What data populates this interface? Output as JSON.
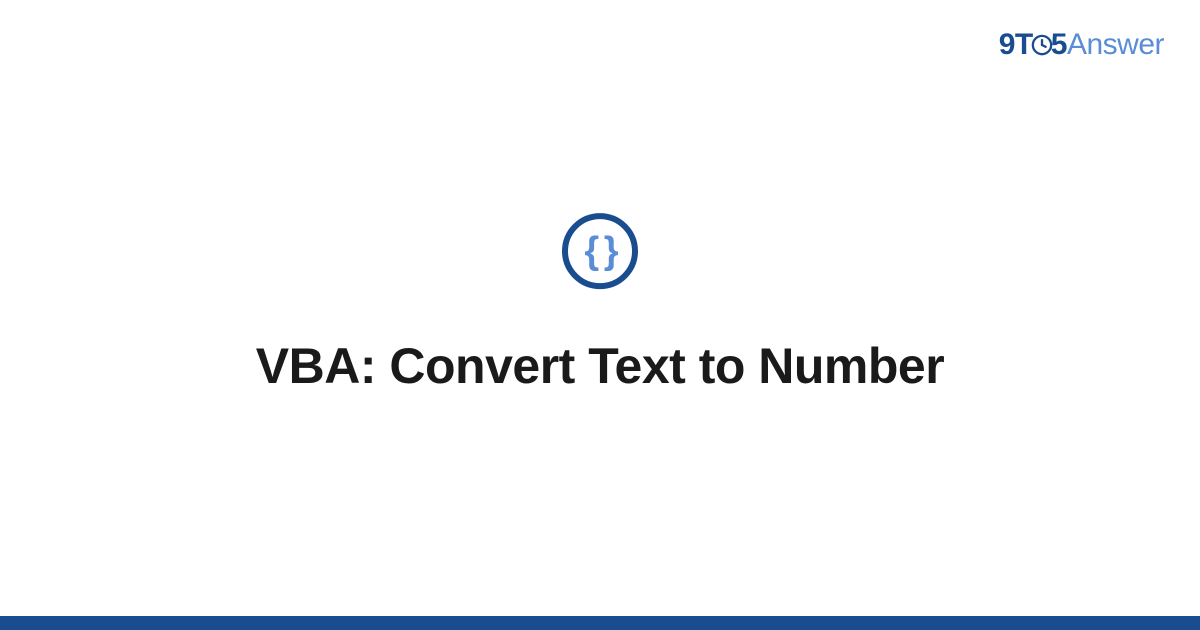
{
  "brand": {
    "part1": "9T",
    "part2": "5",
    "part3": "Answer"
  },
  "icon": {
    "braces": "{ }"
  },
  "title": "VBA: Convert Text to Number",
  "colors": {
    "dark_blue": "#1a4d8f",
    "light_blue": "#5a8dd6",
    "text": "#1a1a1a"
  }
}
